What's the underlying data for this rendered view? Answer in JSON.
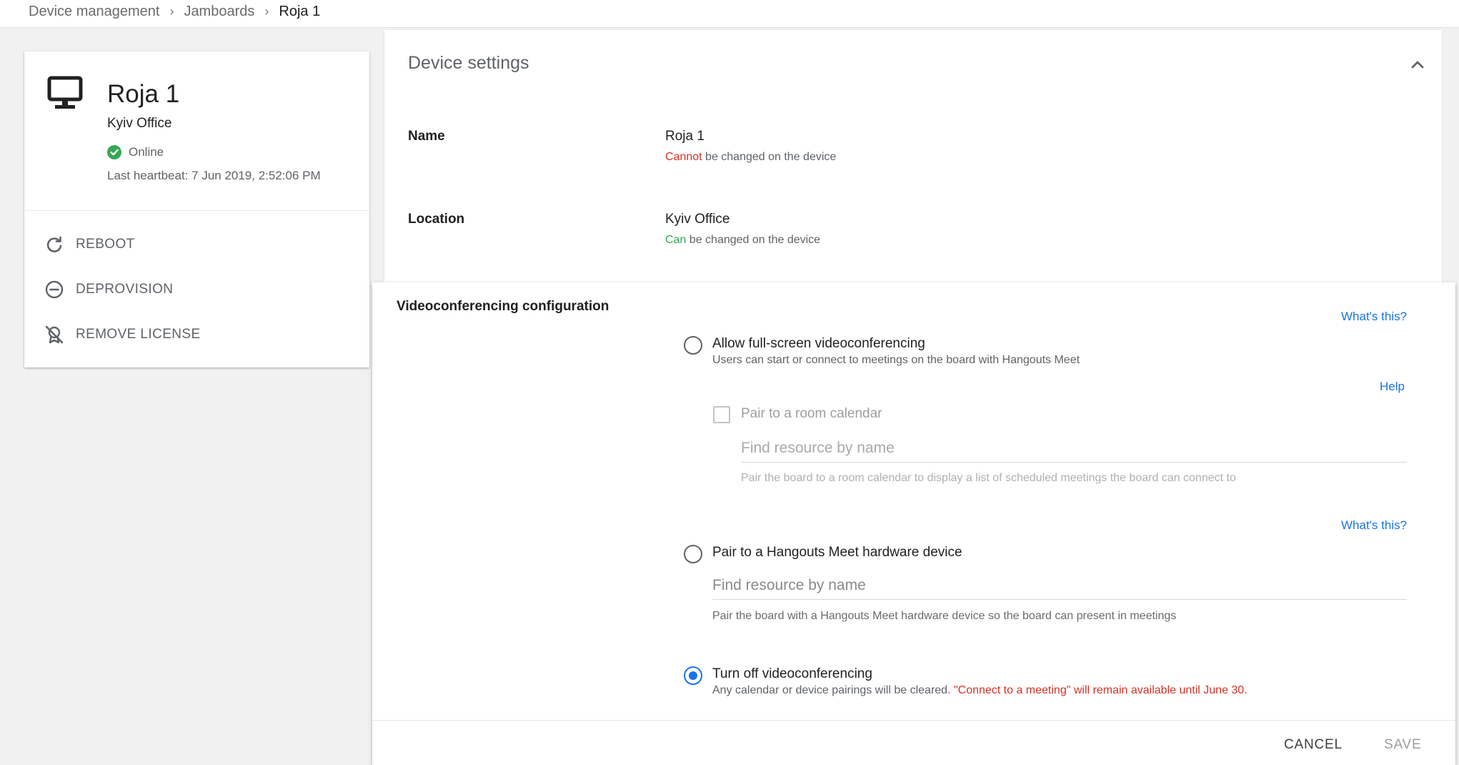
{
  "breadcrumb": {
    "items": [
      "Device management",
      "Jamboards",
      "Roja 1"
    ]
  },
  "device": {
    "name": "Roja 1",
    "location": "Kyiv Office",
    "status": "Online",
    "heartbeat": "Last heartbeat: 7 Jun 2019, 2:52:06 PM",
    "actions": {
      "reboot": "REBOOT",
      "deprovision": "DEPROVISION",
      "remove_license": "REMOVE LICENSE"
    },
    "icon": "monitor-icon",
    "status_color": "#34a853"
  },
  "settings": {
    "title": "Device settings",
    "name_label": "Name",
    "name_value": "Roja 1",
    "name_note_prefix": "Cannot",
    "name_note_rest": " be changed on the device",
    "location_label": "Location",
    "location_value": "Kyiv Office",
    "location_note_prefix": "Can",
    "location_note_rest": " be changed on the device"
  },
  "vc": {
    "title": "Videoconferencing configuration",
    "whats_this": "What's this?",
    "help": "Help",
    "option1": {
      "label": "Allow full-screen videoconferencing",
      "desc": "Users can start or connect to meetings on the board with Hangouts Meet"
    },
    "pair_calendar": {
      "label": "Pair to a room calendar",
      "placeholder": "Find resource by name",
      "hint": "Pair the board to a room calendar to display a list of scheduled meetings the board can connect to"
    },
    "option2": {
      "label": "Pair to a Hangouts Meet hardware device",
      "placeholder": "Find resource by name",
      "hint": "Pair the board with a Hangouts Meet hardware device so the board can present in meetings"
    },
    "option3": {
      "label": "Turn off videoconferencing",
      "desc_prefix": "Any calendar or device pairings will be cleared. ",
      "desc_warning": "\"Connect to a meeting\" will remain available until June 30.",
      "selected": true
    },
    "cancel": "CANCEL",
    "save": "SAVE"
  },
  "colors": {
    "accent": "#1a73e8",
    "warning": "#d93025",
    "success": "#34a853"
  }
}
